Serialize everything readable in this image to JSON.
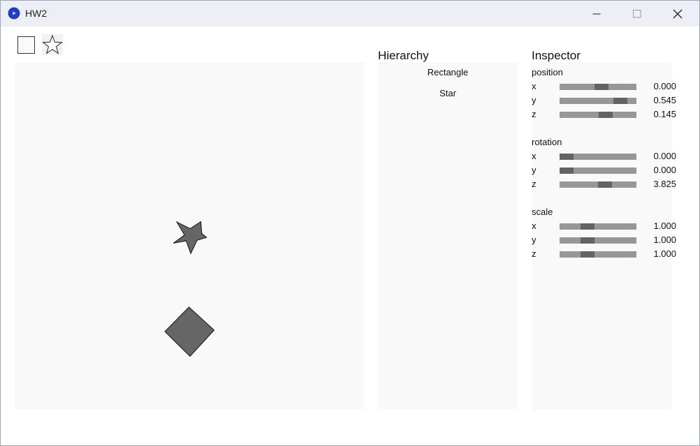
{
  "window": {
    "title": "HW2"
  },
  "toolbar": {
    "tools": [
      "rectangle-tool",
      "star-tool"
    ]
  },
  "hierarchy": {
    "title": "Hierarchy",
    "items": [
      {
        "label": "Rectangle"
      },
      {
        "label": "Star"
      }
    ]
  },
  "inspector": {
    "title": "Inspector",
    "position": {
      "label": "position",
      "x": {
        "axis": "x",
        "value": "0.000",
        "slider": 0.55
      },
      "y": {
        "axis": "y",
        "value": "0.545",
        "slider": 0.85
      },
      "z": {
        "axis": "z",
        "value": "0.145",
        "slider": 0.62
      }
    },
    "rotation": {
      "label": "rotation",
      "x": {
        "axis": "x",
        "value": "0.000",
        "slider": 0.0
      },
      "y": {
        "axis": "y",
        "value": "0.000",
        "slider": 0.0
      },
      "z": {
        "axis": "z",
        "value": "3.825",
        "slider": 0.61
      }
    },
    "scale": {
      "label": "scale",
      "x": {
        "axis": "x",
        "value": "1.000",
        "slider": 0.33
      },
      "y": {
        "axis": "y",
        "value": "1.000",
        "slider": 0.33
      },
      "z": {
        "axis": "z",
        "value": "1.000",
        "slider": 0.33
      }
    }
  },
  "scene": {
    "shape_fill": "#666666",
    "shape_stroke": "#111111",
    "shapes": [
      "star",
      "rectangle"
    ]
  },
  "colors": {
    "titlebar": "#eeeff6",
    "panel_bg": "#f9f9f9",
    "slider_track": "#979797",
    "slider_knob": "#636363",
    "app_icon": "#1f3fb4"
  }
}
